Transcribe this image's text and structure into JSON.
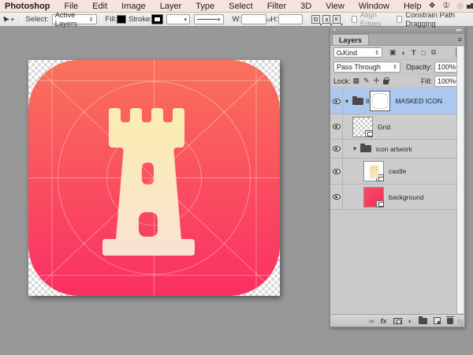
{
  "menu_bar": {
    "items": [
      "Photoshop",
      "File",
      "Edit",
      "Image",
      "Layer",
      "Type",
      "Select",
      "Filter",
      "3D",
      "View",
      "Window",
      "Help"
    ],
    "status_icons": [
      "dropbox-icon",
      "one-circle-icon",
      "loop-icon",
      "truck-icon",
      "battery-icon",
      "display-mirroring-icon"
    ]
  },
  "options_bar": {
    "select_label": "Select:",
    "select_value": "Active Layers",
    "fill_label": "Fill:",
    "stroke_label": "Stroke:",
    "w_label": "W:",
    "w_value": "",
    "h_label": "H:",
    "h_value": "",
    "align_edges_label": "Align Edges",
    "constrain_label": "Constrain Path Dragging"
  },
  "layers_panel": {
    "tab": "Layers",
    "filter_kind": "Kind",
    "blend_mode": "Pass Through",
    "opacity_label": "Opacity:",
    "opacity_value": "100%",
    "lock_label": "Lock:",
    "fill_label": "Fill:",
    "fill_value": "100%",
    "layers": [
      {
        "name": "MASKED ICON",
        "type": "group-with-vector-mask",
        "selected": true,
        "expanded": true
      },
      {
        "name": "Grid",
        "type": "smart-object",
        "selected": false
      },
      {
        "name": "icon artwork",
        "type": "group",
        "selected": false,
        "expanded": true
      },
      {
        "name": "castle",
        "type": "smart-object",
        "selected": false
      },
      {
        "name": "background",
        "type": "smart-object",
        "selected": false
      }
    ]
  },
  "icons": {
    "dropdown_arrow": "▾",
    "updown_arrow": "⇕",
    "panel_menu": "≡",
    "collapse_arrows": "▸▸",
    "dock_mark": "×",
    "link_chain": "∞",
    "fx": "fx",
    "adjustment_half_circle": "◐",
    "mask_link": "8",
    "type_T": "T",
    "shape_square": "□",
    "smart_object": "⧉",
    "picture": "▣",
    "lock_transparency": "▦",
    "lock_paint": "✎",
    "lock_move": "✛",
    "dropbox": "❖",
    "one_circle": "①",
    "loop": "◎",
    "battery": "▯",
    "expand_tri": "▾"
  },
  "colors": {
    "icon_gradient_top": "#f9725b",
    "icon_gradient_bottom": "#fa2f63",
    "castle_gradient_top": "#faedb0",
    "castle_gradient_bottom": "#f9e2d1",
    "grid_line": "rgba(255,255,255,0.35)",
    "selection_blue": "#abc8f0",
    "menubar_bg": "#f6e3de"
  }
}
